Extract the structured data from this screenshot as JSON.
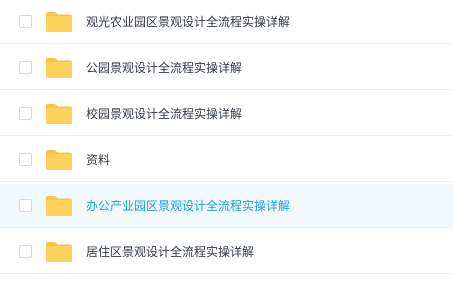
{
  "files": [
    {
      "name": "观光农业园区景观设计全流程实操详解",
      "type": "folder",
      "hovered": false
    },
    {
      "name": "公园景观设计全流程实操详解",
      "type": "folder",
      "hovered": false
    },
    {
      "name": "校园景观设计全流程实操详解",
      "type": "folder",
      "hovered": false
    },
    {
      "name": "资料",
      "type": "folder",
      "hovered": false
    },
    {
      "name": "办公产业园区景观设计全流程实操详解",
      "type": "folder",
      "hovered": true
    },
    {
      "name": "居住区景观设计全流程实操详解",
      "type": "folder",
      "hovered": false
    }
  ],
  "colors": {
    "folder": "#ffd15b",
    "folder_tab": "#f7c544",
    "hover_text": "#1a9ee6",
    "hover_bg": "#f2f9fd",
    "text": "#333a44"
  },
  "icons": {
    "folder": "folder-icon",
    "checkbox": "checkbox"
  }
}
